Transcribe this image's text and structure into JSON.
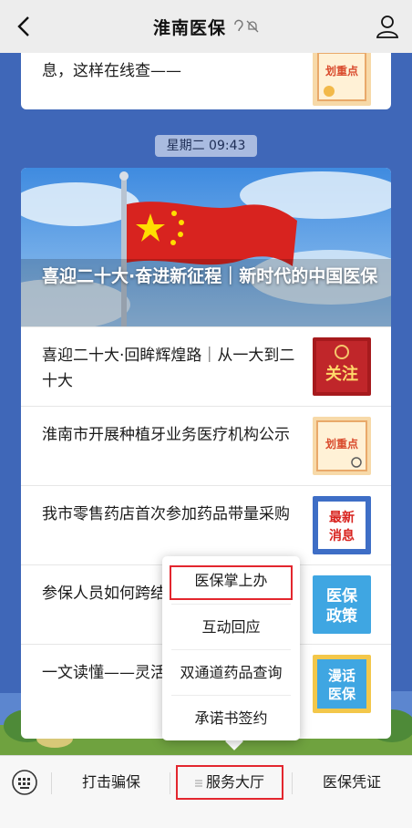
{
  "header": {
    "title": "淮南医保"
  },
  "top_card": {
    "text": "息，这样在线查——"
  },
  "timestamp": "星期二 09:43",
  "main_card": {
    "cover_title": "喜迎二十大·奋进新征程｜新时代的中国医保",
    "items": [
      {
        "text": "喜迎二十大·回眸辉煌路｜从一大到二十大",
        "thumb_label": "关注"
      },
      {
        "text": "淮南市开展种植牙业务医疗机构公示",
        "thumb_label": "划重点"
      },
      {
        "text": "我市零售药店首次参加药品带量采购",
        "thumb_label": "最新消息"
      },
      {
        "text": "参保人员如何跨结算？权威解答",
        "thumb_label": "医保政策"
      },
      {
        "text": "一文读懂——灵活何选择医保？",
        "thumb_label": "漫话医保"
      }
    ]
  },
  "popup_menu": {
    "items": [
      "医保掌上办",
      "互动回应",
      "双通道药品查询",
      "承诺书签约"
    ]
  },
  "bottom_bar": {
    "tabs": [
      "打击骗保",
      "服务大厅",
      "医保凭证"
    ]
  },
  "colors": {
    "background": "#3f67b8",
    "highlight": "#e3262e",
    "flag_red": "#d8231f"
  }
}
